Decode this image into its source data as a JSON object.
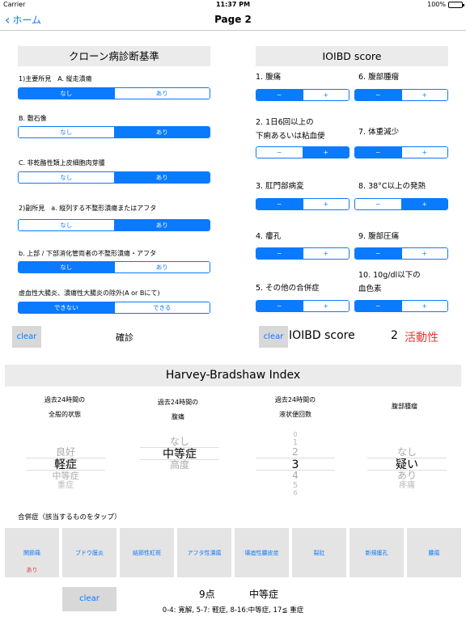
{
  "status_bar": {
    "carrier": "Carrier",
    "time": "11:37 PM",
    "battery": "100%"
  },
  "nav": {
    "back_label": "ホーム",
    "title": "Page 2"
  },
  "crohn": {
    "title": "クローン病診断基準",
    "items": [
      {
        "label": "1)主要所見　A. 縦走潰瘍",
        "options": [
          "なし",
          "あり"
        ],
        "selected": 0
      },
      {
        "label": "B. 敷石像",
        "options": [
          "なし",
          "あり"
        ],
        "selected": 1
      },
      {
        "label": "C. 非乾酪性類上皮細胞肉芽腫",
        "options": [
          "なし",
          "あり"
        ],
        "selected": 1
      },
      {
        "label": "2)副所見　a. 縦列する不整形潰瘍またはアフタ",
        "options": [
          "なし",
          "あり"
        ],
        "selected": 1
      },
      {
        "label": "b. 上部 / 下部消化管両者の不整形潰瘍・アフタ",
        "options": [
          "なし",
          "あり"
        ],
        "selected": 0
      },
      {
        "label": "虚血性大腸炎、潰瘍性大腸炎の除外(A or Bにて)",
        "options": [
          "できない",
          "できる"
        ],
        "selected": 0
      }
    ],
    "clear_label": "clear",
    "result": "確診"
  },
  "ioibd": {
    "title": "IOIBD score",
    "left": [
      {
        "label_lines": [
          "1. 腹痛"
        ],
        "selected": 0
      },
      {
        "label_lines": [
          "2. 1日6回以上の",
          "下痢あるいは粘血便"
        ],
        "selected": 1
      },
      {
        "label_lines": [
          "3. 肛門部病変"
        ],
        "selected": 0
      },
      {
        "label_lines": [
          "4. 瘻孔"
        ],
        "selected": 0
      },
      {
        "label_lines": [
          "5. その他の合併症"
        ],
        "selected": 0
      }
    ],
    "right": [
      {
        "label_lines": [
          "6. 腹部腫瘤"
        ],
        "selected": 0
      },
      {
        "label_lines": [
          "7. 体重減少"
        ],
        "selected": 0
      },
      {
        "label_lines": [
          "8. 38°C以上の発熱"
        ],
        "selected": 1
      },
      {
        "label_lines": [
          "9. 腹部圧痛"
        ],
        "selected": 0
      },
      {
        "label_lines": [
          "10. 10g/dl以下の",
          "血色素"
        ],
        "selected": 0
      }
    ],
    "minus": "−",
    "plus": "+",
    "clear_label": "clear",
    "score_label": "IOIBD score",
    "score_value": "2",
    "activity": "活動性"
  },
  "hbi": {
    "title": "Harvey-Bradshaw Index",
    "columns": [
      {
        "label_lines": [
          "過去24時間の",
          "全般的状態"
        ],
        "items": [
          "良好",
          "軽症",
          "中等症",
          "重症"
        ],
        "selected": 1
      },
      {
        "label_lines": [
          "過去24時間の",
          "腹痛"
        ],
        "items": [
          "なし",
          "中等症",
          "高度"
        ],
        "selected": 1
      },
      {
        "label_lines": [
          "過去24時間の",
          "液状便回数"
        ],
        "items": [
          "0",
          "1",
          "2",
          "3",
          "4",
          "5",
          "6"
        ],
        "selected": 3
      },
      {
        "label_lines": [
          "腹部腫瘤"
        ],
        "items": [
          "なし",
          "疑い",
          "あり",
          "疼痛"
        ],
        "selected": 1
      }
    ],
    "complications_label": "合併症（該当するものをタップ）",
    "complications": [
      {
        "name": "関節痛",
        "flag": "あり"
      },
      {
        "name": "ブドウ膜炎",
        "flag": ""
      },
      {
        "name": "結節性紅斑",
        "flag": ""
      },
      {
        "name": "アフタ性潰瘍",
        "flag": ""
      },
      {
        "name": "壊疽性膿皮症",
        "flag": ""
      },
      {
        "name": "裂肛",
        "flag": ""
      },
      {
        "name": "新規瘻孔",
        "flag": ""
      },
      {
        "name": "膿瘍",
        "flag": ""
      }
    ],
    "clear_label": "clear",
    "score_text": "9点",
    "severity_text": "中等症",
    "legend": "0-4: 寛解, 5-7: 軽症, 8-16:中等症, 17≦ 重症"
  },
  "colors": {
    "accent": "#0a7aff",
    "alert": "#e53935",
    "panel": "#ebebeb"
  }
}
